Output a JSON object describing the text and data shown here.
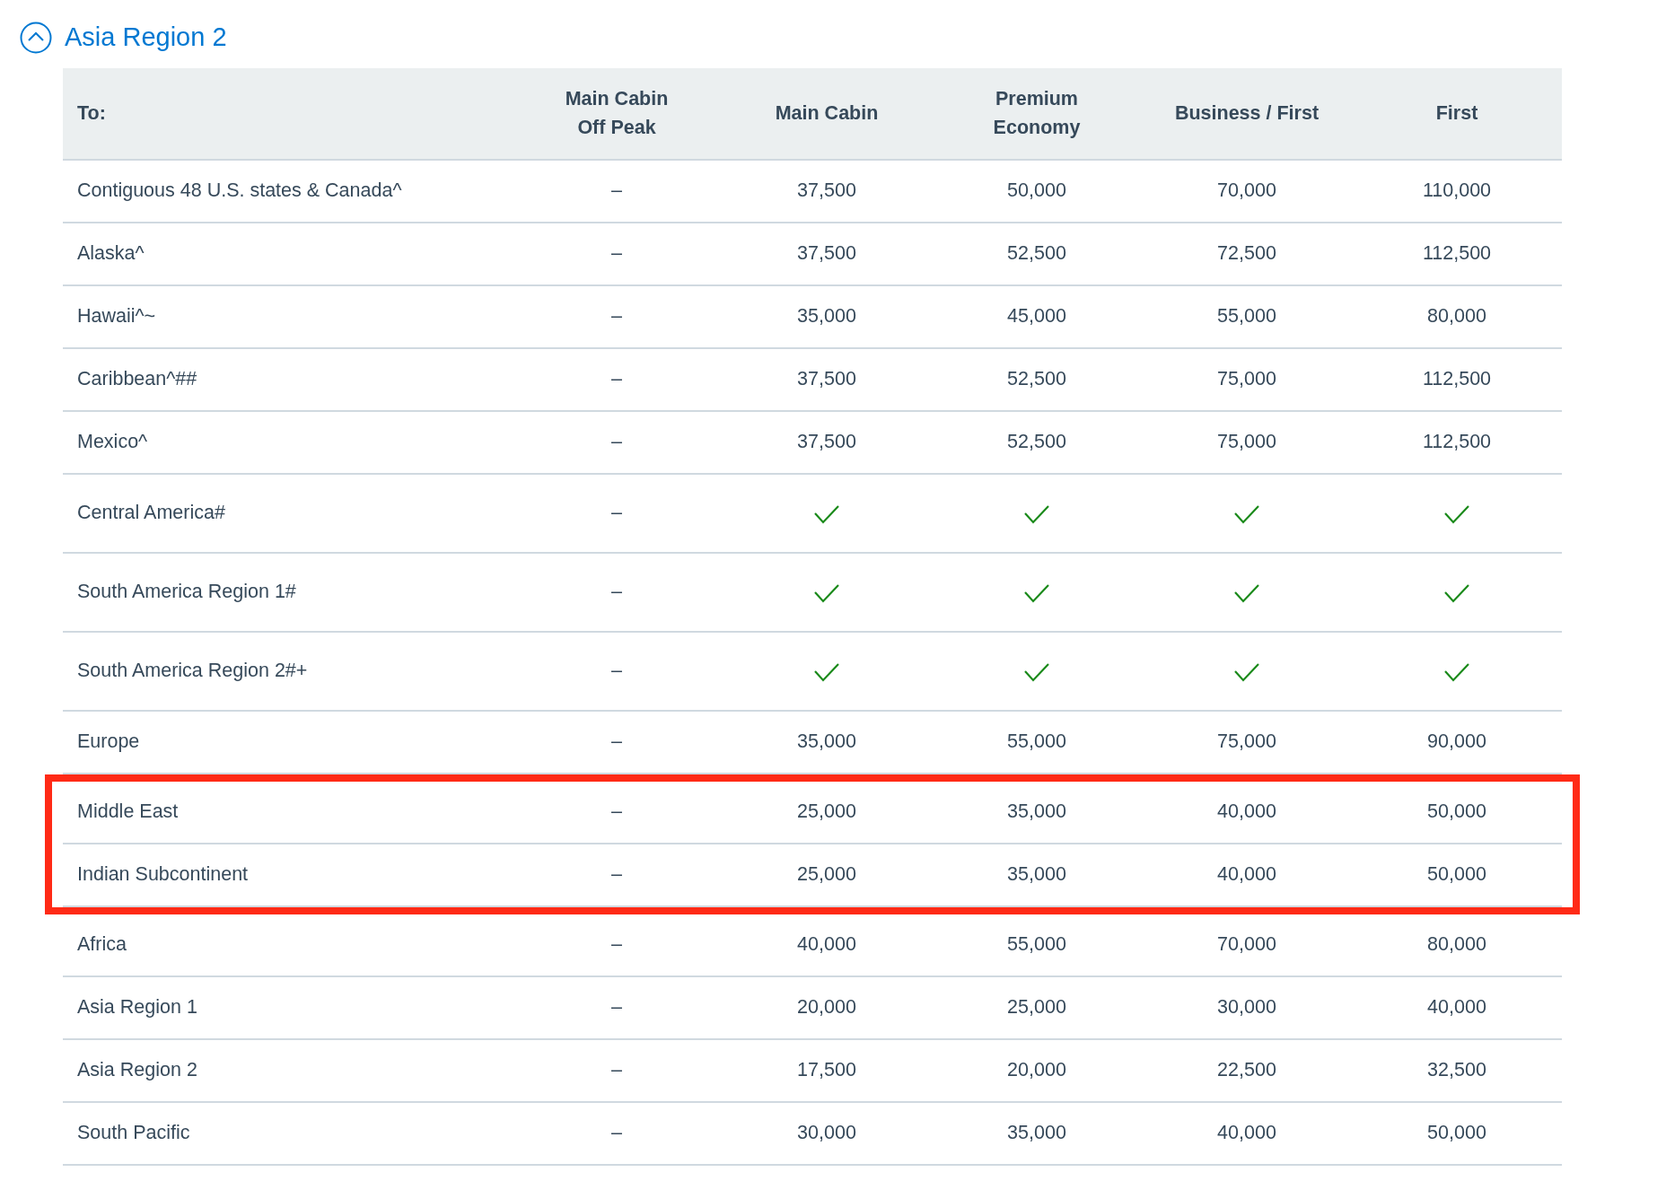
{
  "section": {
    "title": "Asia Region 2",
    "expanded": true
  },
  "table": {
    "columns": [
      "To:",
      "Main Cabin\nOff Peak",
      "Main Cabin",
      "Premium\nEconomy",
      "Business / First",
      "First"
    ],
    "rows": [
      {
        "highlighted": false,
        "cells": [
          {
            "kind": "text",
            "text": "Contiguous 48 U.S. states & Canada^"
          },
          {
            "kind": "text",
            "text": "–"
          },
          {
            "kind": "text",
            "text": "37,500"
          },
          {
            "kind": "text",
            "text": "50,000"
          },
          {
            "kind": "text",
            "text": "70,000"
          },
          {
            "kind": "text",
            "text": "110,000"
          }
        ]
      },
      {
        "highlighted": false,
        "cells": [
          {
            "kind": "text",
            "text": "Alaska^"
          },
          {
            "kind": "text",
            "text": "–"
          },
          {
            "kind": "text",
            "text": "37,500"
          },
          {
            "kind": "text",
            "text": "52,500"
          },
          {
            "kind": "text",
            "text": "72,500"
          },
          {
            "kind": "text",
            "text": "112,500"
          }
        ]
      },
      {
        "highlighted": false,
        "cells": [
          {
            "kind": "text",
            "text": "Hawaii^~"
          },
          {
            "kind": "text",
            "text": "–"
          },
          {
            "kind": "text",
            "text": "35,000"
          },
          {
            "kind": "text",
            "text": "45,000"
          },
          {
            "kind": "text",
            "text": "55,000"
          },
          {
            "kind": "text",
            "text": "80,000"
          }
        ]
      },
      {
        "highlighted": false,
        "cells": [
          {
            "kind": "text",
            "text": "Caribbean^##"
          },
          {
            "kind": "text",
            "text": "–"
          },
          {
            "kind": "text",
            "text": "37,500"
          },
          {
            "kind": "text",
            "text": "52,500"
          },
          {
            "kind": "text",
            "text": "75,000"
          },
          {
            "kind": "text",
            "text": "112,500"
          }
        ]
      },
      {
        "highlighted": false,
        "cells": [
          {
            "kind": "text",
            "text": "Mexico^"
          },
          {
            "kind": "text",
            "text": "–"
          },
          {
            "kind": "text",
            "text": "37,500"
          },
          {
            "kind": "text",
            "text": "52,500"
          },
          {
            "kind": "text",
            "text": "75,000"
          },
          {
            "kind": "text",
            "text": "112,500"
          }
        ]
      },
      {
        "highlighted": false,
        "cells": [
          {
            "kind": "text",
            "text": "Central America#"
          },
          {
            "kind": "text",
            "text": "–"
          },
          {
            "kind": "check"
          },
          {
            "kind": "check"
          },
          {
            "kind": "check"
          },
          {
            "kind": "check"
          }
        ]
      },
      {
        "highlighted": false,
        "cells": [
          {
            "kind": "text",
            "text": "South America Region 1#"
          },
          {
            "kind": "text",
            "text": "–"
          },
          {
            "kind": "check"
          },
          {
            "kind": "check"
          },
          {
            "kind": "check"
          },
          {
            "kind": "check"
          }
        ]
      },
      {
        "highlighted": false,
        "cells": [
          {
            "kind": "text",
            "text": "South America Region 2#+"
          },
          {
            "kind": "text",
            "text": "–"
          },
          {
            "kind": "check"
          },
          {
            "kind": "check"
          },
          {
            "kind": "check"
          },
          {
            "kind": "check"
          }
        ]
      },
      {
        "highlighted": false,
        "cells": [
          {
            "kind": "text",
            "text": "Europe"
          },
          {
            "kind": "text",
            "text": "–"
          },
          {
            "kind": "text",
            "text": "35,000"
          },
          {
            "kind": "text",
            "text": "55,000"
          },
          {
            "kind": "text",
            "text": "75,000"
          },
          {
            "kind": "text",
            "text": "90,000"
          }
        ]
      },
      {
        "highlighted": true,
        "cells": [
          {
            "kind": "text",
            "text": "Middle East"
          },
          {
            "kind": "text",
            "text": "–"
          },
          {
            "kind": "text",
            "text": "25,000"
          },
          {
            "kind": "text",
            "text": "35,000"
          },
          {
            "kind": "text",
            "text": "40,000"
          },
          {
            "kind": "text",
            "text": "50,000"
          }
        ]
      },
      {
        "highlighted": true,
        "cells": [
          {
            "kind": "text",
            "text": "Indian Subcontinent"
          },
          {
            "kind": "text",
            "text": "–"
          },
          {
            "kind": "text",
            "text": "25,000"
          },
          {
            "kind": "text",
            "text": "35,000"
          },
          {
            "kind": "text",
            "text": "40,000"
          },
          {
            "kind": "text",
            "text": "50,000"
          }
        ]
      },
      {
        "highlighted": false,
        "cells": [
          {
            "kind": "text",
            "text": "Africa"
          },
          {
            "kind": "text",
            "text": "–"
          },
          {
            "kind": "text",
            "text": "40,000"
          },
          {
            "kind": "text",
            "text": "55,000"
          },
          {
            "kind": "text",
            "text": "70,000"
          },
          {
            "kind": "text",
            "text": "80,000"
          }
        ]
      },
      {
        "highlighted": false,
        "cells": [
          {
            "kind": "text",
            "text": "Asia Region 1"
          },
          {
            "kind": "text",
            "text": "–"
          },
          {
            "kind": "text",
            "text": "20,000"
          },
          {
            "kind": "text",
            "text": "25,000"
          },
          {
            "kind": "text",
            "text": "30,000"
          },
          {
            "kind": "text",
            "text": "40,000"
          }
        ]
      },
      {
        "highlighted": false,
        "cells": [
          {
            "kind": "text",
            "text": "Asia Region 2"
          },
          {
            "kind": "text",
            "text": "–"
          },
          {
            "kind": "text",
            "text": "17,500"
          },
          {
            "kind": "text",
            "text": "20,000"
          },
          {
            "kind": "text",
            "text": "22,500"
          },
          {
            "kind": "text",
            "text": "32,500"
          }
        ]
      },
      {
        "highlighted": false,
        "cells": [
          {
            "kind": "text",
            "text": "South Pacific"
          },
          {
            "kind": "text",
            "text": "–"
          },
          {
            "kind": "text",
            "text": "30,000"
          },
          {
            "kind": "text",
            "text": "35,000"
          },
          {
            "kind": "text",
            "text": "40,000"
          },
          {
            "kind": "text",
            "text": "50,000"
          }
        ]
      }
    ]
  }
}
